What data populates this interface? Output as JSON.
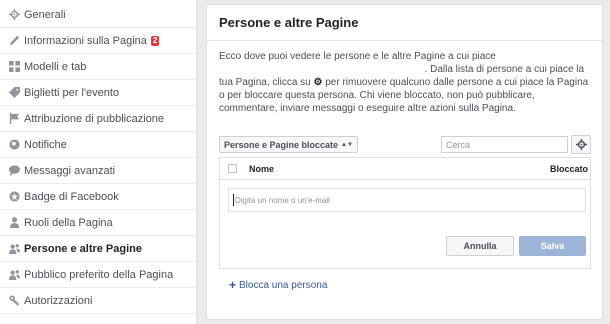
{
  "sidebar": {
    "items": [
      {
        "label": "Generali",
        "icon": "gear-icon"
      },
      {
        "label": "Informazioni sulla Pagina",
        "icon": "pencil-icon",
        "badge": "2"
      },
      {
        "label": "Modelli e tab",
        "icon": "grid-icon"
      },
      {
        "label": "Biglietti per l'evento",
        "icon": "tag-icon"
      },
      {
        "label": "Attribuzione di pubblicazione",
        "icon": "flag-icon"
      },
      {
        "label": "Notifiche",
        "icon": "globe-icon"
      },
      {
        "label": "Messaggi avanzati",
        "icon": "chat-bubble-icon"
      },
      {
        "label": "Badge di Facebook",
        "icon": "star-icon"
      },
      {
        "label": "Ruoli della Pagina",
        "icon": "person-icon"
      },
      {
        "label": "Persone e altre Pagine",
        "icon": "people-icon",
        "active": true
      },
      {
        "label": "Pubblico preferito della Pagina",
        "icon": "people-icon"
      },
      {
        "label": "Autorizzazioni",
        "icon": "wrench-icon"
      }
    ]
  },
  "main": {
    "title": "Persone e altre Pagine",
    "description_part1": "Ecco dove puoi vedere le persone e le altre Pagine a cui piace",
    "description_part2": ". Dalla lista di persone a cui piace la tua Pagina, clicca su",
    "description_part3": "per rimuovere qualcuno dalle persone a cui piace la Pagina o per bloccare questa persona. Chi viene bloccato, non può pubblicare, commentare, inviare messaggi o eseguire altre azioni sulla Pagina.",
    "filter_label": "Persone e Pagine bloccate",
    "search_placeholder": "Cerca",
    "table": {
      "col_name": "Nome",
      "col_blocked": "Bloccato"
    },
    "name_input_placeholder": "Digita un nome o un'e-mail",
    "cancel_label": "Annulla",
    "save_label": "Salva",
    "block_link": "Blocca una persona"
  },
  "colors": {
    "accent": "#365899",
    "save_disabled": "#9cb4d8",
    "badge": "#e0393e"
  }
}
